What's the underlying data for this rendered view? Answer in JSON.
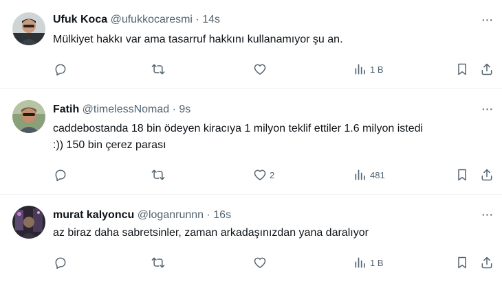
{
  "tweets": [
    {
      "name": "Ufuk Koca",
      "handle": "@ufukkocaresmi",
      "dot": "·",
      "time": "14s",
      "text": "Mülkiyet hakkı var ama tasarruf hakkını kullanamıyor şu an.",
      "reply_count": "",
      "retweet_count": "",
      "like_count": "",
      "views_count": "1 B"
    },
    {
      "name": "Fatih",
      "handle": "@timelessNomad",
      "dot": "·",
      "time": "9s",
      "text_line1": "caddebostanda 18 bin ödeyen kiracıya 1 milyon teklif ettiler 1.6 milyon istedi",
      "text_line2": ":)) 150 bin çerez parası",
      "reply_count": "",
      "retweet_count": "",
      "like_count": "2",
      "views_count": "481"
    },
    {
      "name": "murat kalyoncu",
      "handle": "@loganrunnn",
      "dot": "·",
      "time": "16s",
      "text": "az biraz daha sabretsinler, zaman arkadaşınızdan yana daralıyor",
      "reply_count": "",
      "retweet_count": "",
      "like_count": "",
      "views_count": "1 B"
    }
  ],
  "icons": {
    "more": "more-icon",
    "reply": "reply-icon",
    "retweet": "retweet-icon",
    "like": "heart-icon",
    "views": "views-icon",
    "bookmark": "bookmark-icon",
    "share": "share-icon"
  },
  "colors": {
    "text": "#0f1419",
    "secondary": "#536471",
    "divider": "#eff3f4"
  },
  "more_glyph": "···"
}
